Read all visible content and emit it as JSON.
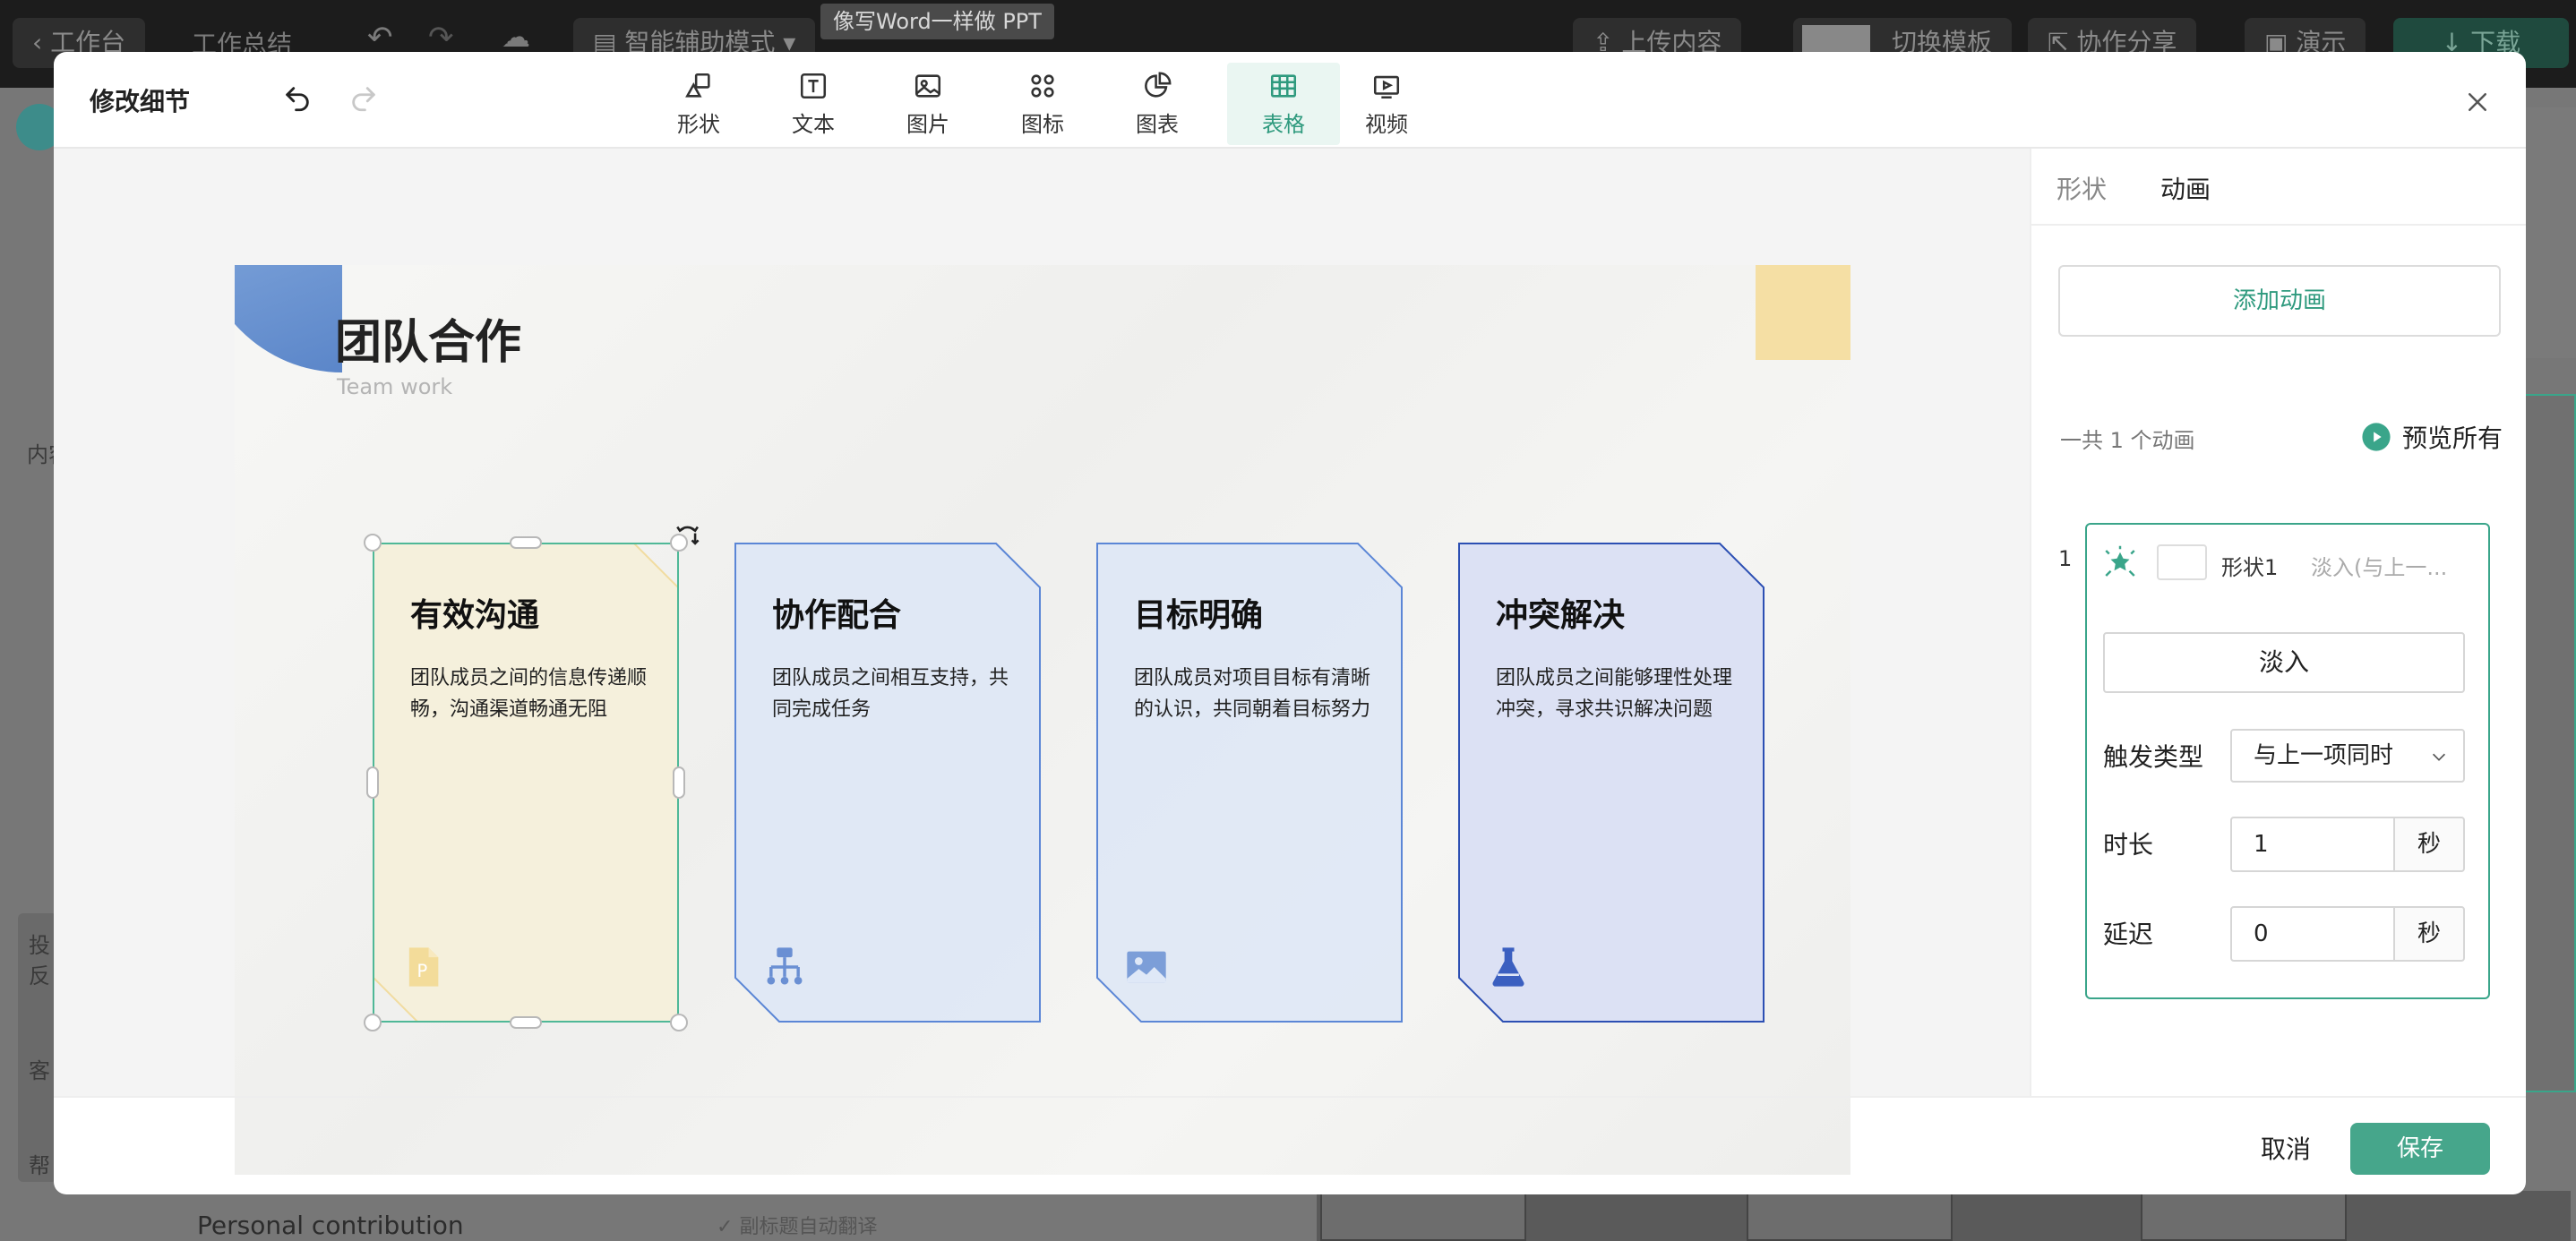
{
  "background_app": {
    "topbar": {
      "back_label": "工作台",
      "doc_title": "工作总结",
      "mode_label": "智能辅助模式",
      "tooltip": "像写Word一样做 PPT",
      "upload_label": "上传内容",
      "switch_template_label": "切换模板",
      "share_label": "协作分享",
      "present_label": "演示",
      "download_label": "下载"
    },
    "sidebar": {
      "content_label": "内容",
      "feedback_label_1": "投",
      "feedback_label_2": "反",
      "service_label": "客",
      "help_label": "帮"
    },
    "bottom": {
      "outline_item": "Personal contribution",
      "auto_translate": "副标题自动翻译"
    }
  },
  "modal": {
    "title": "修改细节",
    "toolbar": [
      {
        "label": "形状",
        "icon": "shape-icon"
      },
      {
        "label": "文本",
        "icon": "text-icon"
      },
      {
        "label": "图片",
        "icon": "image-icon"
      },
      {
        "label": "图标",
        "icon": "icons-icon"
      },
      {
        "label": "图表",
        "icon": "chart-icon"
      },
      {
        "label": "表格",
        "icon": "table-icon",
        "active": true
      },
      {
        "label": "视频",
        "icon": "video-icon"
      }
    ],
    "slide": {
      "title": "团队合作",
      "subtitle": "Team work",
      "cards": [
        {
          "title": "有效沟通",
          "text": "团队成员之间的信息传递顺畅，沟通渠道畅通无阻",
          "icon": "document-icon",
          "selected": true
        },
        {
          "title": "协作配合",
          "text": "团队成员之间相互支持，共同完成任务",
          "icon": "org-chart-icon"
        },
        {
          "title": "目标明确",
          "text": "团队成员对项目目标有清晰的认识，共同朝着目标努力",
          "icon": "picture-icon"
        },
        {
          "title": "冲突解决",
          "text": "团队成员之间能够理性处理冲突，寻求共识解决问题",
          "icon": "flask-icon"
        }
      ]
    },
    "panel": {
      "tabs": [
        {
          "label": "形状",
          "active": false
        },
        {
          "label": "动画",
          "active": true
        }
      ],
      "add_animation_label": "添加动画",
      "count_label": "一共 1 个动画",
      "preview_all_label": "预览所有",
      "animation": {
        "index": "1",
        "shape_name": "形状1",
        "effect_summary": "淡入(与上一...",
        "effect_label": "淡入",
        "trigger_label": "触发类型",
        "trigger_value": "与上一项同时",
        "duration_label": "时长",
        "duration_value": "1",
        "duration_unit": "秒",
        "delay_label": "延迟",
        "delay_value": "0",
        "delay_unit": "秒"
      }
    },
    "footer": {
      "cancel_label": "取消",
      "save_label": "保存"
    }
  },
  "colors": {
    "accent": "#46a68b",
    "accent_text": "#2f9a7e",
    "card_selected_fill": "#f5efd9",
    "card_blue_fill": "#dde6f6",
    "card_blue_stroke": "#5b86d6",
    "card_dark_stroke": "#2c4fb3"
  }
}
